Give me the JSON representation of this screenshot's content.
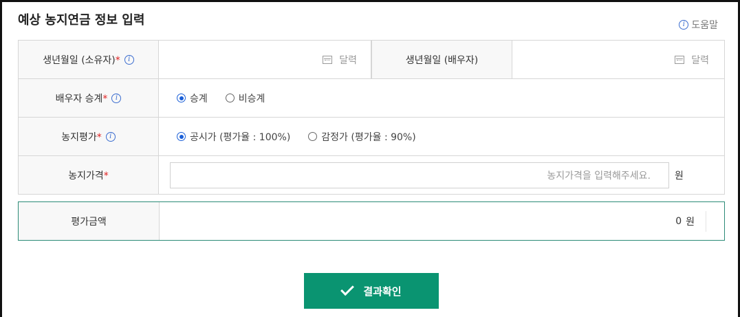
{
  "page": {
    "title": "예상 농지연금 정보 입력",
    "help_label": "도움말"
  },
  "rows": {
    "birth_owner": {
      "label": "생년월일 (소유자)",
      "required": "*",
      "calendar_label": "달력"
    },
    "birth_spouse": {
      "label": "생년월일 (배우자)",
      "calendar_label": "달력"
    },
    "spouse_succession": {
      "label": "배우자 승계",
      "required": "*",
      "options": [
        {
          "label": "승계",
          "selected": true
        },
        {
          "label": "비승계",
          "selected": false
        }
      ]
    },
    "land_evaluation": {
      "label": "농지평가",
      "required": "*",
      "options": [
        {
          "label": "공시가 (평가율 : 100%)",
          "selected": true
        },
        {
          "label": "감정가 (평가율 : 90%)",
          "selected": false
        }
      ]
    },
    "land_price": {
      "label": "농지가격",
      "required": "*",
      "placeholder": "농지가격을 입력해주세요.",
      "unit": "원"
    }
  },
  "result": {
    "label": "평가금액",
    "value": "0",
    "unit": "원"
  },
  "submit": {
    "label": "결과확인"
  },
  "colors": {
    "accent": "#0a9471",
    "required": "#e02020",
    "radio_selected": "#1a5fd8",
    "info_icon": "#3a6ccf"
  }
}
